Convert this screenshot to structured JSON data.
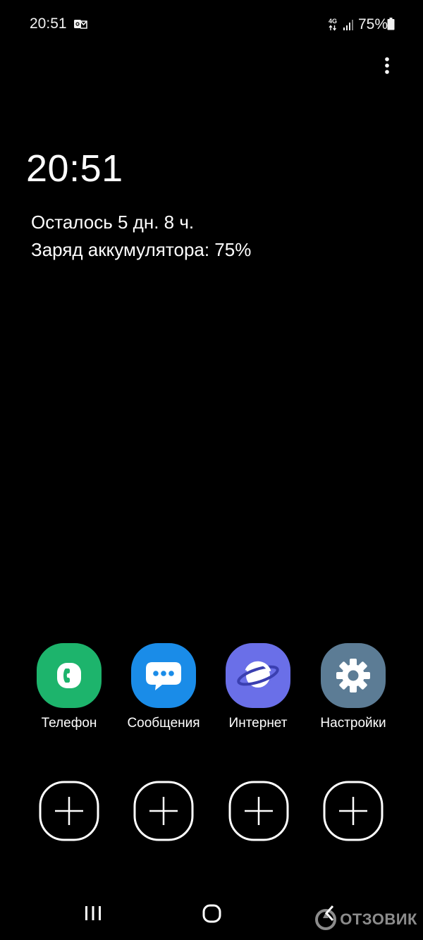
{
  "status_bar": {
    "time": "20:51",
    "network_type": "4G",
    "battery_percent": "75%",
    "notification_icon": "outlook-mail-icon",
    "signal_icon": "signal-bars-icon",
    "battery_icon": "battery-icon"
  },
  "menu": {
    "icon": "more-vertical-icon"
  },
  "clock": {
    "time": "20:51"
  },
  "battery_info": {
    "remaining": "Осталось 5 дн. 8 ч.",
    "charge": "Заряд аккумулятора: 75%"
  },
  "apps": [
    {
      "label": "Телефон",
      "icon": "phone-icon",
      "color": "#1db46c"
    },
    {
      "label": "Сообщения",
      "icon": "messages-icon",
      "color": "#1a8ce8"
    },
    {
      "label": "Интернет",
      "icon": "internet-planet-icon",
      "color": "#6a6fe8"
    },
    {
      "label": "Настройки",
      "icon": "gear-icon",
      "color": "#5c7c95"
    }
  ],
  "add_slots": [
    {
      "icon": "plus-icon"
    },
    {
      "icon": "plus-icon"
    },
    {
      "icon": "plus-icon"
    },
    {
      "icon": "plus-icon"
    }
  ],
  "nav": {
    "recents_icon": "recents-icon",
    "home_icon": "home-icon",
    "back_icon": "back-icon"
  },
  "watermark": {
    "text": "ОТЗОВИК"
  }
}
